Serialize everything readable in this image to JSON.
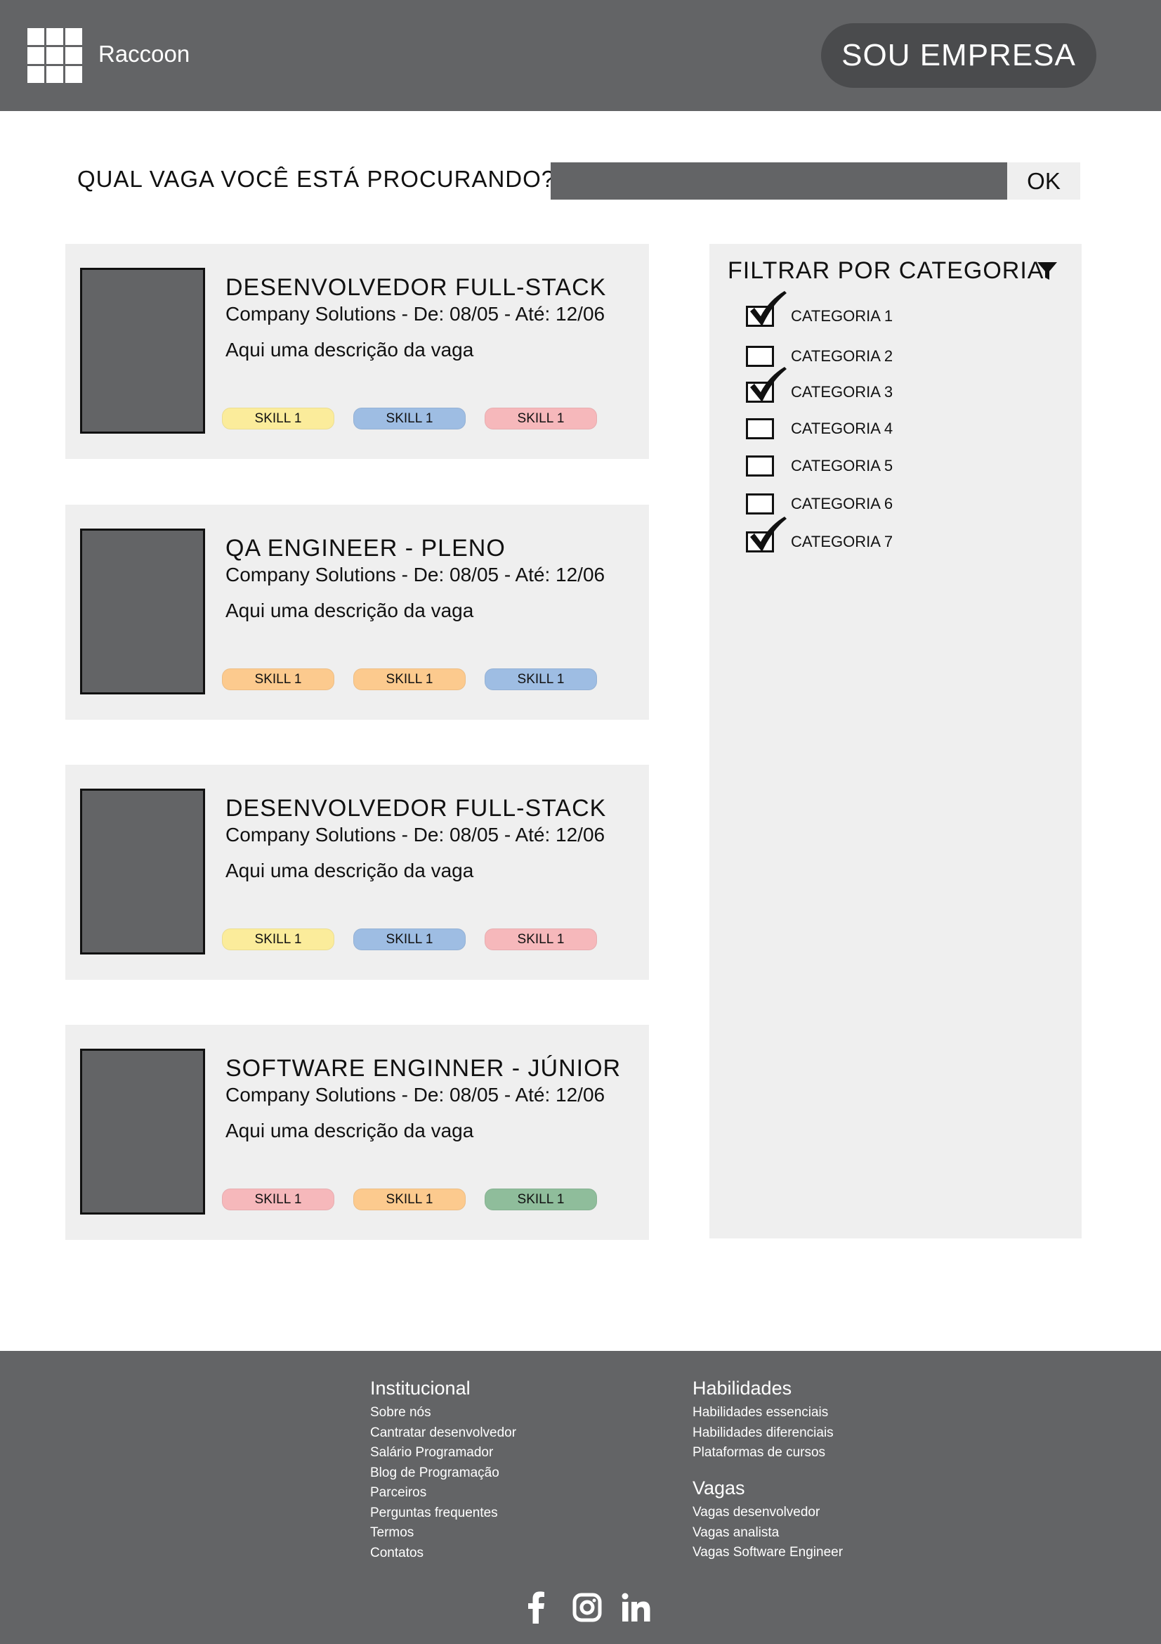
{
  "header": {
    "brand": "Raccoon",
    "cta_label": "SOU EMPRESA"
  },
  "search": {
    "label": "QUAL VAGA VOCÊ ESTÁ PROCURANDO?",
    "value": "",
    "placeholder": "",
    "button_label": "OK"
  },
  "jobs": [
    {
      "title": "DESENVOLVEDOR FULL-STACK",
      "company": "Company Solutions - De: 08/05 - Até: 12/06",
      "description": "Aqui uma descrição da vaga",
      "skills": [
        {
          "label": "SKILL 1",
          "color": "#fbec9b"
        },
        {
          "label": "SKILL 1",
          "color": "#9ebde3"
        },
        {
          "label": "SKILL 1",
          "color": "#f6b8bb"
        }
      ]
    },
    {
      "title": "QA ENGINEER - PLENO",
      "company": "Company Solutions - De: 08/05 - Até: 12/06",
      "description": "Aqui uma descrição da vaga",
      "skills": [
        {
          "label": "SKILL 1",
          "color": "#fcca8e"
        },
        {
          "label": "SKILL 1",
          "color": "#fcca8e"
        },
        {
          "label": "SKILL 1",
          "color": "#9ebde3"
        }
      ]
    },
    {
      "title": "DESENVOLVEDOR FULL-STACK",
      "company": "Company Solutions - De: 08/05 - Até: 12/06",
      "description": "Aqui uma descrição da vaga",
      "skills": [
        {
          "label": "SKILL 1",
          "color": "#fbec9b"
        },
        {
          "label": "SKILL 1",
          "color": "#9ebde3"
        },
        {
          "label": "SKILL 1",
          "color": "#f6b8bb"
        }
      ]
    },
    {
      "title": "SOFTWARE ENGINNER - JÚNIOR",
      "company": "Company Solutions - De: 08/05 - Até: 12/06",
      "description": "Aqui uma descrição da vaga",
      "skills": [
        {
          "label": "SKILL 1",
          "color": "#f6b8bb"
        },
        {
          "label": "SKILL 1",
          "color": "#fcca8e"
        },
        {
          "label": "SKILL 1",
          "color": "#8fbd9b"
        }
      ]
    }
  ],
  "filter": {
    "title": "FILTRAR POR CATEGORIA",
    "icon": "filter-funnel-icon",
    "categories": [
      {
        "label": "CATEGORIA 1",
        "checked": true
      },
      {
        "label": "CATEGORIA 2",
        "checked": false
      },
      {
        "label": "CATEGORIA 3",
        "checked": true
      },
      {
        "label": "CATEGORIA 4",
        "checked": false
      },
      {
        "label": "CATEGORIA 5",
        "checked": false
      },
      {
        "label": "CATEGORIA 6",
        "checked": false
      },
      {
        "label": "CATEGORIA 7",
        "checked": true
      }
    ]
  },
  "footer": {
    "institucional": {
      "heading": "Institucional",
      "links": [
        "Sobre nós",
        "Cantratar desenvolvedor",
        "Salário Programador",
        "Blog de Programação",
        "Parceiros",
        "Perguntas frequentes",
        "Termos",
        "Contatos"
      ]
    },
    "habilidades": {
      "heading": "Habilidades",
      "links": [
        "Habilidades essenciais",
        "Habilidades diferenciais",
        "Plataformas de cursos"
      ]
    },
    "vagas": {
      "heading": "Vagas",
      "links": [
        "Vagas desenvolvedor",
        "Vagas analista",
        "Vagas Software Engineer"
      ]
    },
    "social": [
      "facebook-icon",
      "instagram-icon",
      "linkedin-icon"
    ]
  },
  "colors": {
    "header_bg": "#636466",
    "panel_bg": "#efefef",
    "button_dark": "#4a4b4d"
  }
}
